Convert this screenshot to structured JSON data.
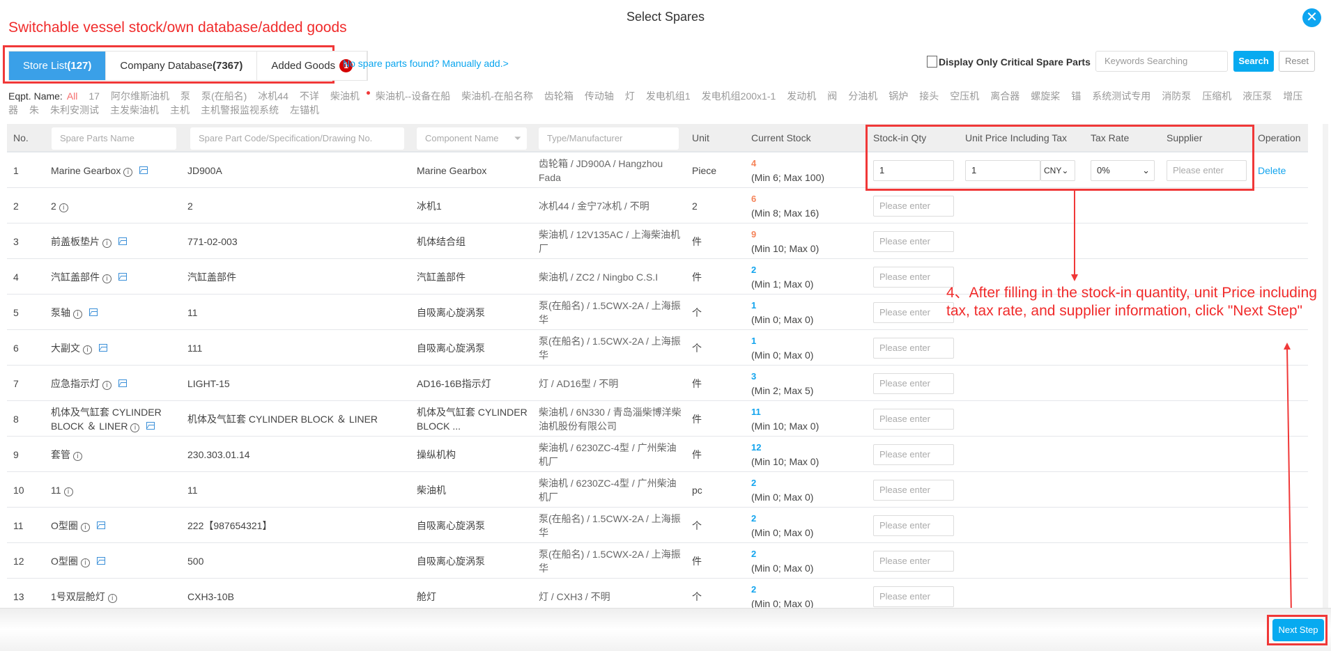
{
  "dialog": {
    "title": "Select Spares",
    "close_icon": "close-icon"
  },
  "annotations": {
    "top": "Switchable vessel stock/own database/added goods",
    "step": "4、After filling in the stock-in quantity, unit Price including tax, tax rate, and supplier information, click \"Next Step\""
  },
  "tabs": [
    {
      "label": "Store List",
      "count": "(127)",
      "active": true
    },
    {
      "label": "Company Database",
      "count": "(7367)"
    },
    {
      "label": "Added Goods",
      "badge": "1"
    }
  ],
  "manual_add": "No spare parts found? Manually add.>",
  "critical_only": {
    "label": "Display Only Critical Spare Parts",
    "checked": false
  },
  "search": {
    "placeholder": "Keywords Searching",
    "search_label": "Search",
    "reset_label": "Reset"
  },
  "eqpt": {
    "label": "Eqpt. Name:",
    "selected": "All",
    "items": [
      "All",
      "17",
      "阿尔维斯油机",
      "泵",
      "泵(在船名)",
      "冰机44",
      "不详",
      "柴油机",
      "柴油机--设备在船",
      "柴油机-在船名称",
      "齿轮箱",
      "传动轴",
      "灯",
      "发电机组1",
      "发电机组200x1-1",
      "发动机",
      "阀",
      "分油机",
      "锅炉",
      "接头",
      "空压机",
      "离合器",
      "螺旋桨",
      "锚",
      "系统测试专用",
      "消防泵",
      "压缩机",
      "液压泵",
      "增压器",
      "朱",
      "朱利安测试",
      "主发柴油机",
      "主机",
      "主机警报监视系统",
      "左锚机"
    ],
    "dot_item": "柴油机"
  },
  "table": {
    "headers": {
      "no": "No.",
      "name_ph": "Spare Parts Name",
      "code_ph": "Spare Part Code/Specification/Drawing No.",
      "component_ph": "Component Name",
      "type_ph": "Type/Manufacturer",
      "unit": "Unit",
      "stock": "Current Stock",
      "qty": "Stock-in Qty",
      "price": "Unit Price Including Tax",
      "tax": "Tax Rate",
      "supplier": "Supplier",
      "operation": "Operation"
    },
    "input_placeholder": "Please enter",
    "colors": {
      "below_min": "#f5845a",
      "normal": "#12a4ee"
    },
    "rows": [
      {
        "no": "1",
        "name": "Marine Gearbox",
        "img": true,
        "code": "JD900A",
        "component": "Marine Gearbox",
        "type": "齿轮箱 / JD900A / Hangzhou Fada",
        "unit": "Piece",
        "stock": "4",
        "range": "(Min 6; Max 100)",
        "low": true,
        "qty": "1",
        "price": "1",
        "currency": "CNY",
        "tax": "0%",
        "operation": "Delete"
      },
      {
        "no": "2",
        "name": "2",
        "img": false,
        "code": "2",
        "component": "冰机1",
        "type": "冰机44 / 金宁7冰机 / 不明",
        "unit": "2",
        "stock": "6",
        "range": "(Min 8; Max 16)",
        "low": true
      },
      {
        "no": "3",
        "name": "前盖板垫片",
        "img": true,
        "code": "771-02-003",
        "component": "机体结合组",
        "type": "柴油机 / 12V135AC / 上海柴油机厂",
        "unit": "件",
        "stock": "9",
        "range": "(Min 10; Max 0)",
        "low": true
      },
      {
        "no": "4",
        "name": "汽缸盖部件",
        "img": true,
        "code": "汽缸盖部件",
        "component": "汽缸盖部件",
        "type": "柴油机 / ZC2 / Ningbo C.S.I",
        "unit": "件",
        "stock": "2",
        "range": "(Min 1; Max 0)"
      },
      {
        "no": "5",
        "name": "泵轴",
        "img": true,
        "code": "11",
        "component": "自吸离心旋涡泵",
        "type": "泵(在船名) / 1.5CWX-2A / 上海振华",
        "unit": "个",
        "stock": "1",
        "range": "(Min 0; Max 0)"
      },
      {
        "no": "6",
        "name": "大副文",
        "img": true,
        "code": "111",
        "component": "自吸离心旋涡泵",
        "type": "泵(在船名) / 1.5CWX-2A / 上海振华",
        "unit": "个",
        "stock": "1",
        "range": "(Min 0; Max 0)"
      },
      {
        "no": "7",
        "name": "应急指示灯",
        "img": true,
        "code": "LIGHT-15",
        "component": "AD16-16B指示灯",
        "type": "灯 / AD16型 / 不明",
        "unit": "件",
        "stock": "3",
        "range": "(Min 2; Max 5)"
      },
      {
        "no": "8",
        "name": "机体及气缸套 CYLINDER BLOCK ＆ LINER",
        "img": true,
        "code": "机体及气缸套 CYLINDER BLOCK ＆ LINER",
        "component": "机体及气缸套 CYLINDER BLOCK ...",
        "type": "柴油机 / 6N330 / 青岛淄柴博洋柴油机股份有限公司",
        "unit": "件",
        "stock": "11",
        "range": "(Min 10; Max 0)"
      },
      {
        "no": "9",
        "name": "套管",
        "img": false,
        "code": "230.303.01.14",
        "component": "操纵机构",
        "type": "柴油机 / 6230ZC-4型 / 广州柴油机厂",
        "unit": "件",
        "stock": "12",
        "range": "(Min 10; Max 0)"
      },
      {
        "no": "10",
        "name": "11",
        "img": false,
        "code": "11",
        "component": "柴油机",
        "type": "柴油机 / 6230ZC-4型 / 广州柴油机厂",
        "unit": "pc",
        "stock": "2",
        "range": "(Min 0; Max 0)"
      },
      {
        "no": "11",
        "name": "O型圈",
        "img": true,
        "code": "222【987654321】",
        "component": "自吸离心旋涡泵",
        "type": "泵(在船名) / 1.5CWX-2A / 上海振华",
        "unit": "个",
        "stock": "2",
        "range": "(Min 0; Max 0)"
      },
      {
        "no": "12",
        "name": "O型圈",
        "img": true,
        "code": "500",
        "component": "自吸离心旋涡泵",
        "type": "泵(在船名) / 1.5CWX-2A / 上海振华",
        "unit": "件",
        "stock": "2",
        "range": "(Min 0; Max 0)"
      },
      {
        "no": "13",
        "name": "1号双层舱灯",
        "img": false,
        "code": "CXH3-10B",
        "component": "舱灯",
        "type": "灯 / CXH3 / 不明",
        "unit": "个",
        "stock": "2",
        "range": "(Min 0; Max 0)"
      }
    ]
  },
  "footer": {
    "next_label": "Next Step"
  }
}
